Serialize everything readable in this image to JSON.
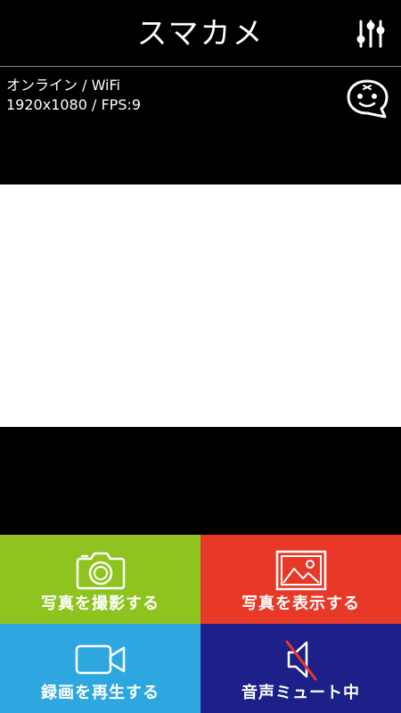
{
  "header": {
    "title": "スマカメ",
    "settings_icon": "sliders-icon"
  },
  "status": {
    "connection": "オンライン / WiFi",
    "resolution_fps": "1920x1080 / FPS:9",
    "face_icon": "face-chat-icon"
  },
  "preview": {
    "background": "#ffffff"
  },
  "controls": {
    "take_photo": {
      "label": "写真を撮影する",
      "icon": "camera-icon",
      "color": "#8fc31f"
    },
    "view_photo": {
      "label": "写真を表示する",
      "icon": "image-icon",
      "color": "#e83828"
    },
    "record_video": {
      "label": "録画を再生する",
      "icon": "video-camera-icon",
      "color": "#2ea7e0"
    },
    "audio_mute": {
      "label": "音声ミュート中",
      "icon": "speaker-muted-icon",
      "color": "#1d2088",
      "mute_slash_color": "#e83828"
    }
  }
}
